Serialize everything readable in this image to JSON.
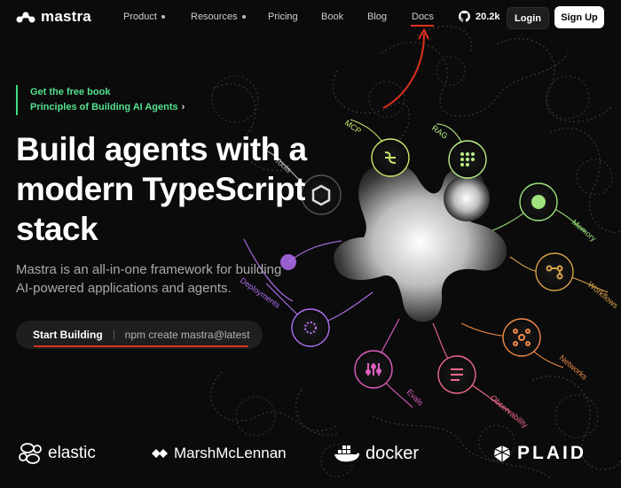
{
  "nav": {
    "logo": "mastra",
    "items": [
      {
        "label": "Product",
        "has_dot": true
      },
      {
        "label": "Resources",
        "has_dot": true
      },
      {
        "label": "Pricing",
        "has_dot": false
      },
      {
        "label": "Book",
        "has_dot": false
      },
      {
        "label": "Blog",
        "has_dot": false
      },
      {
        "label": "Docs",
        "has_dot": false
      }
    ],
    "github_stars": "20.2k",
    "login": "Login",
    "signup": "Sign Up"
  },
  "book": {
    "line1": "Get the free book",
    "line2": "Principles of Building AI Agents",
    "arrow": "›"
  },
  "hero": {
    "title": "Build agents with a modern TypeScript stack",
    "subtitle": "Mastra is an all-in-one framework for building AI-powered applications and agents."
  },
  "cta": {
    "start": "Start Building",
    "command": "npm create mastra@latest"
  },
  "graph_labels": [
    {
      "text": "Tools",
      "color": "#bdbdbd"
    },
    {
      "text": "MCP",
      "color": "#c9e86a"
    },
    {
      "text": "RAG",
      "color": "#b9f08a"
    },
    {
      "text": "Memory",
      "color": "#9ee37d"
    },
    {
      "text": "Workflows",
      "color": "#d9a24b"
    },
    {
      "text": "Networks",
      "color": "#f08a48"
    },
    {
      "text": "Observability",
      "color": "#f06a8a"
    },
    {
      "text": "Evals",
      "color": "#e060c0"
    },
    {
      "text": "Deployments",
      "color": "#b070f0"
    }
  ],
  "partners": [
    "elastic",
    "MarshMcLennan",
    "docker",
    "PLAID"
  ],
  "colors": {
    "accent_green": "#54e08f",
    "annotation_red": "#e0301e",
    "background": "#0b0b0b"
  }
}
